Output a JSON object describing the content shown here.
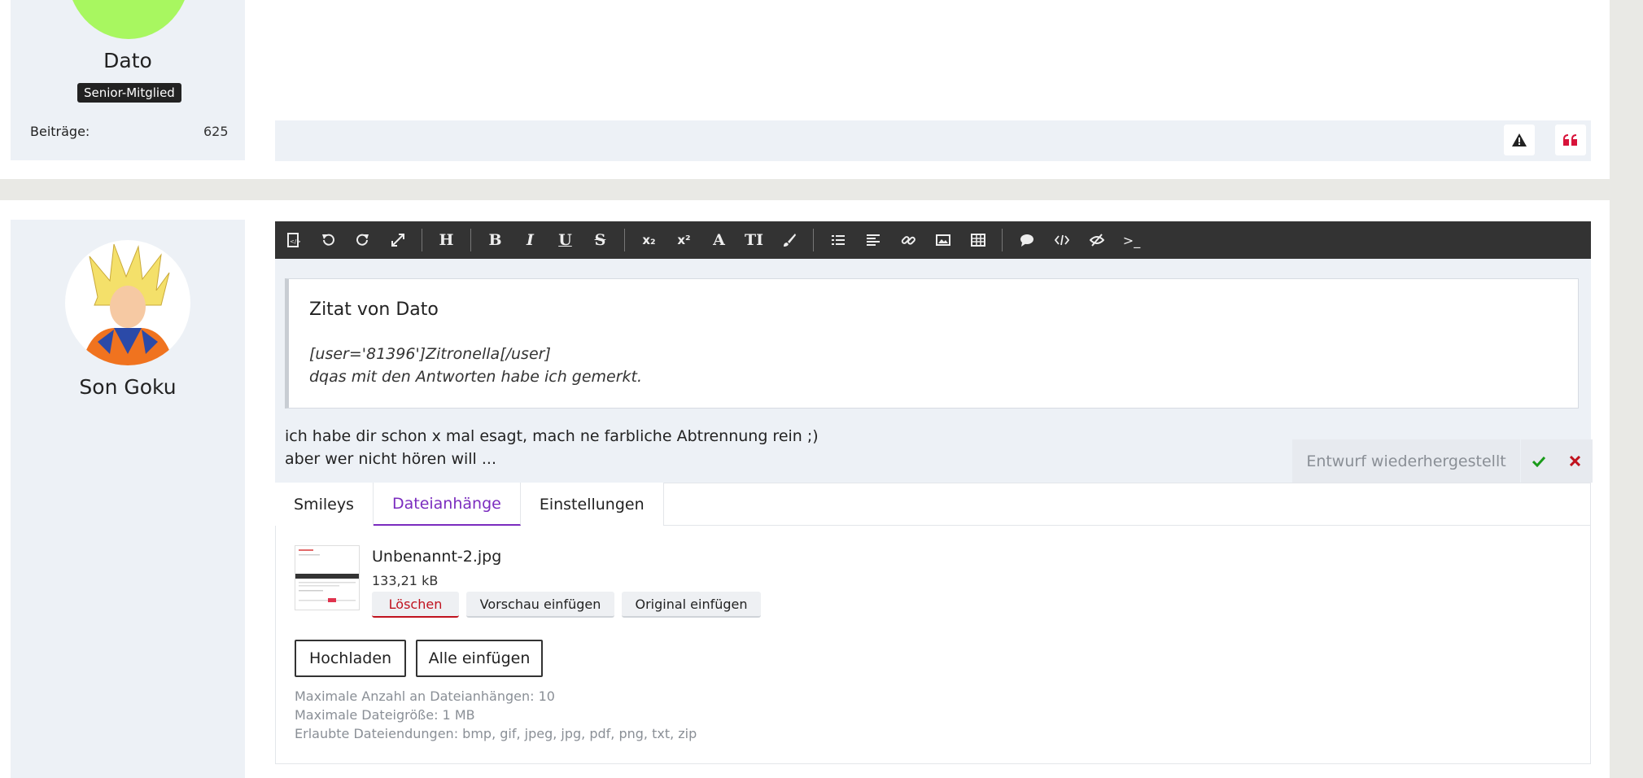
{
  "post1": {
    "author": "Dato",
    "rank_badge": "Senior-Mitglied",
    "stats": {
      "label": "Beiträge:",
      "value": "625"
    },
    "actions": [
      "warning-icon",
      "quote-icon"
    ]
  },
  "post2": {
    "author": "Son Goku"
  },
  "editor": {
    "toolbar": [
      "source-icon",
      "undo-icon",
      "redo-icon",
      "fullscreen-icon",
      "H",
      "B",
      "I",
      "U",
      "S",
      "subscript-icon",
      "superscript-icon",
      "A",
      "TI",
      "paintbrush-icon",
      "list-icon",
      "align-icon",
      "link-icon",
      "image-icon",
      "table-icon",
      "quote-bubble-icon",
      "code-icon",
      "spoiler-icon",
      "terminal-icon"
    ],
    "quote": {
      "title": "Zitat von Dato",
      "lines": [
        "[user='81396']Zitronella[/user]",
        "dqas mit den Antworten habe ich gemerkt."
      ]
    },
    "body_lines": [
      "ich habe dir schon x mal esagt, mach ne farbliche Abtrennung rein ;)",
      "aber wer nicht hören will ..."
    ],
    "draft_status": "Entwurf wiederhergestellt"
  },
  "tabs": [
    {
      "label": "Smileys",
      "active": false
    },
    {
      "label": "Dateianhänge",
      "active": true
    },
    {
      "label": "Einstellungen",
      "active": false
    }
  ],
  "attachment": {
    "filename": "Unbenannt-2.jpg",
    "size": "133,21 kB",
    "buttons": {
      "delete": "Löschen",
      "insert_preview": "Vorschau einfügen",
      "insert_original": "Original einfügen"
    }
  },
  "upload": {
    "upload_label": "Hochladen",
    "insert_all_label": "Alle einfügen"
  },
  "limits": [
    "Maximale Anzahl an Dateianhängen: 10",
    "Maximale Dateigröße: 1 MB",
    "Erlaubte Dateiendungen: bmp, gif, jpeg, jpg, pdf, png, txt, zip"
  ],
  "colors": {
    "accent": "#7b2cbf",
    "danger": "#c0121e",
    "confirm": "#1a9b1a",
    "toolbar": "#333333",
    "avatar_green": "#a8f760"
  }
}
